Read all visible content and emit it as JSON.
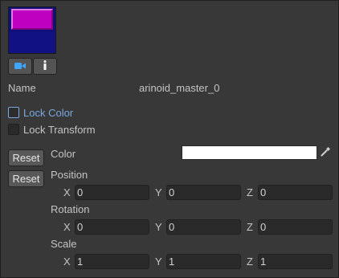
{
  "preview": {
    "top_color": "#c000c0",
    "bottom_color": "#111184"
  },
  "toolbar": {
    "camera_icon": "camera-icon",
    "info_icon": "info-icon"
  },
  "name_row": {
    "label": "Name",
    "value": "arinoid_master_0"
  },
  "lock_color": {
    "label": "Lock Color",
    "checked": false
  },
  "lock_transform": {
    "label": "Lock Transform",
    "checked": false
  },
  "color_row": {
    "reset_label": "Reset",
    "label": "Color",
    "value_hex": "#ffffff"
  },
  "position": {
    "reset_label": "Reset",
    "label": "Position",
    "x_label": "X",
    "x": "0",
    "y_label": "Y",
    "y": "0",
    "z_label": "Z",
    "z": "0"
  },
  "rotation": {
    "label": "Rotation",
    "x_label": "X",
    "x": "0",
    "y_label": "Y",
    "y": "0",
    "z_label": "Z",
    "z": "0"
  },
  "scale": {
    "label": "Scale",
    "x_label": "X",
    "x": "1",
    "y_label": "Y",
    "y": "1",
    "z_label": "Z",
    "z": "1"
  },
  "colors": {
    "accent_focus": "#7aa7e0",
    "panel_bg": "#383838",
    "icon_blue": "#3ea6ff"
  }
}
